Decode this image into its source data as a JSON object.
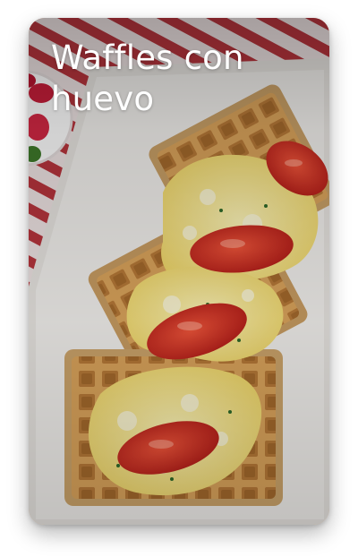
{
  "card": {
    "title": "Waffles con huevo",
    "image_subject": "waffles-with-scrambled-eggs-and-tomato-photo"
  },
  "colors": {
    "title_text": "#ffffff",
    "page_background": "#ffffff"
  }
}
